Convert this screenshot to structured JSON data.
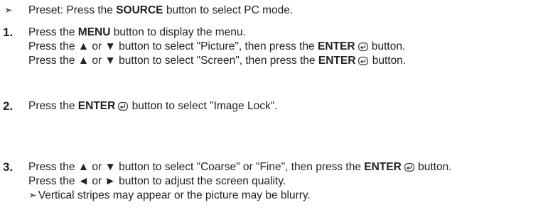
{
  "preset": {
    "marker": "➣",
    "pre": "Preset: Press the ",
    "bold": "SOURCE",
    "post": " button to select PC mode."
  },
  "steps": [
    {
      "number": "1.",
      "lines": [
        {
          "pre": "Press the ",
          "bold": "MENU",
          "post": " button to display the menu."
        },
        {
          "pre": "Press the ▲ or ▼ button to select \"Picture\", then press the ",
          "bold": "ENTER",
          "post": " button."
        },
        {
          "pre": "Press the ▲ or ▼ button to select \"Screen\", then press the ",
          "bold": "ENTER",
          "post": " button."
        }
      ]
    },
    {
      "number": "2.",
      "lines": [
        {
          "pre": "Press the ",
          "bold": "ENTER",
          "post": " button to select \"Image Lock\"."
        }
      ]
    },
    {
      "number": "3.",
      "lines": [
        {
          "pre": "Press the ▲ or ▼ button to select \"Coarse\" or \"Fine\", then press the ",
          "bold": "ENTER",
          "post": " button."
        },
        {
          "pre": "Press the ◄ or ► button to adjust the screen quality."
        }
      ],
      "note": {
        "marker": "➣",
        "text": "Vertical stripes may appear or the picture may be blurry."
      }
    }
  ],
  "icons": {
    "enter": "enter-icon",
    "note_arrow": "arrow-right-icon"
  }
}
